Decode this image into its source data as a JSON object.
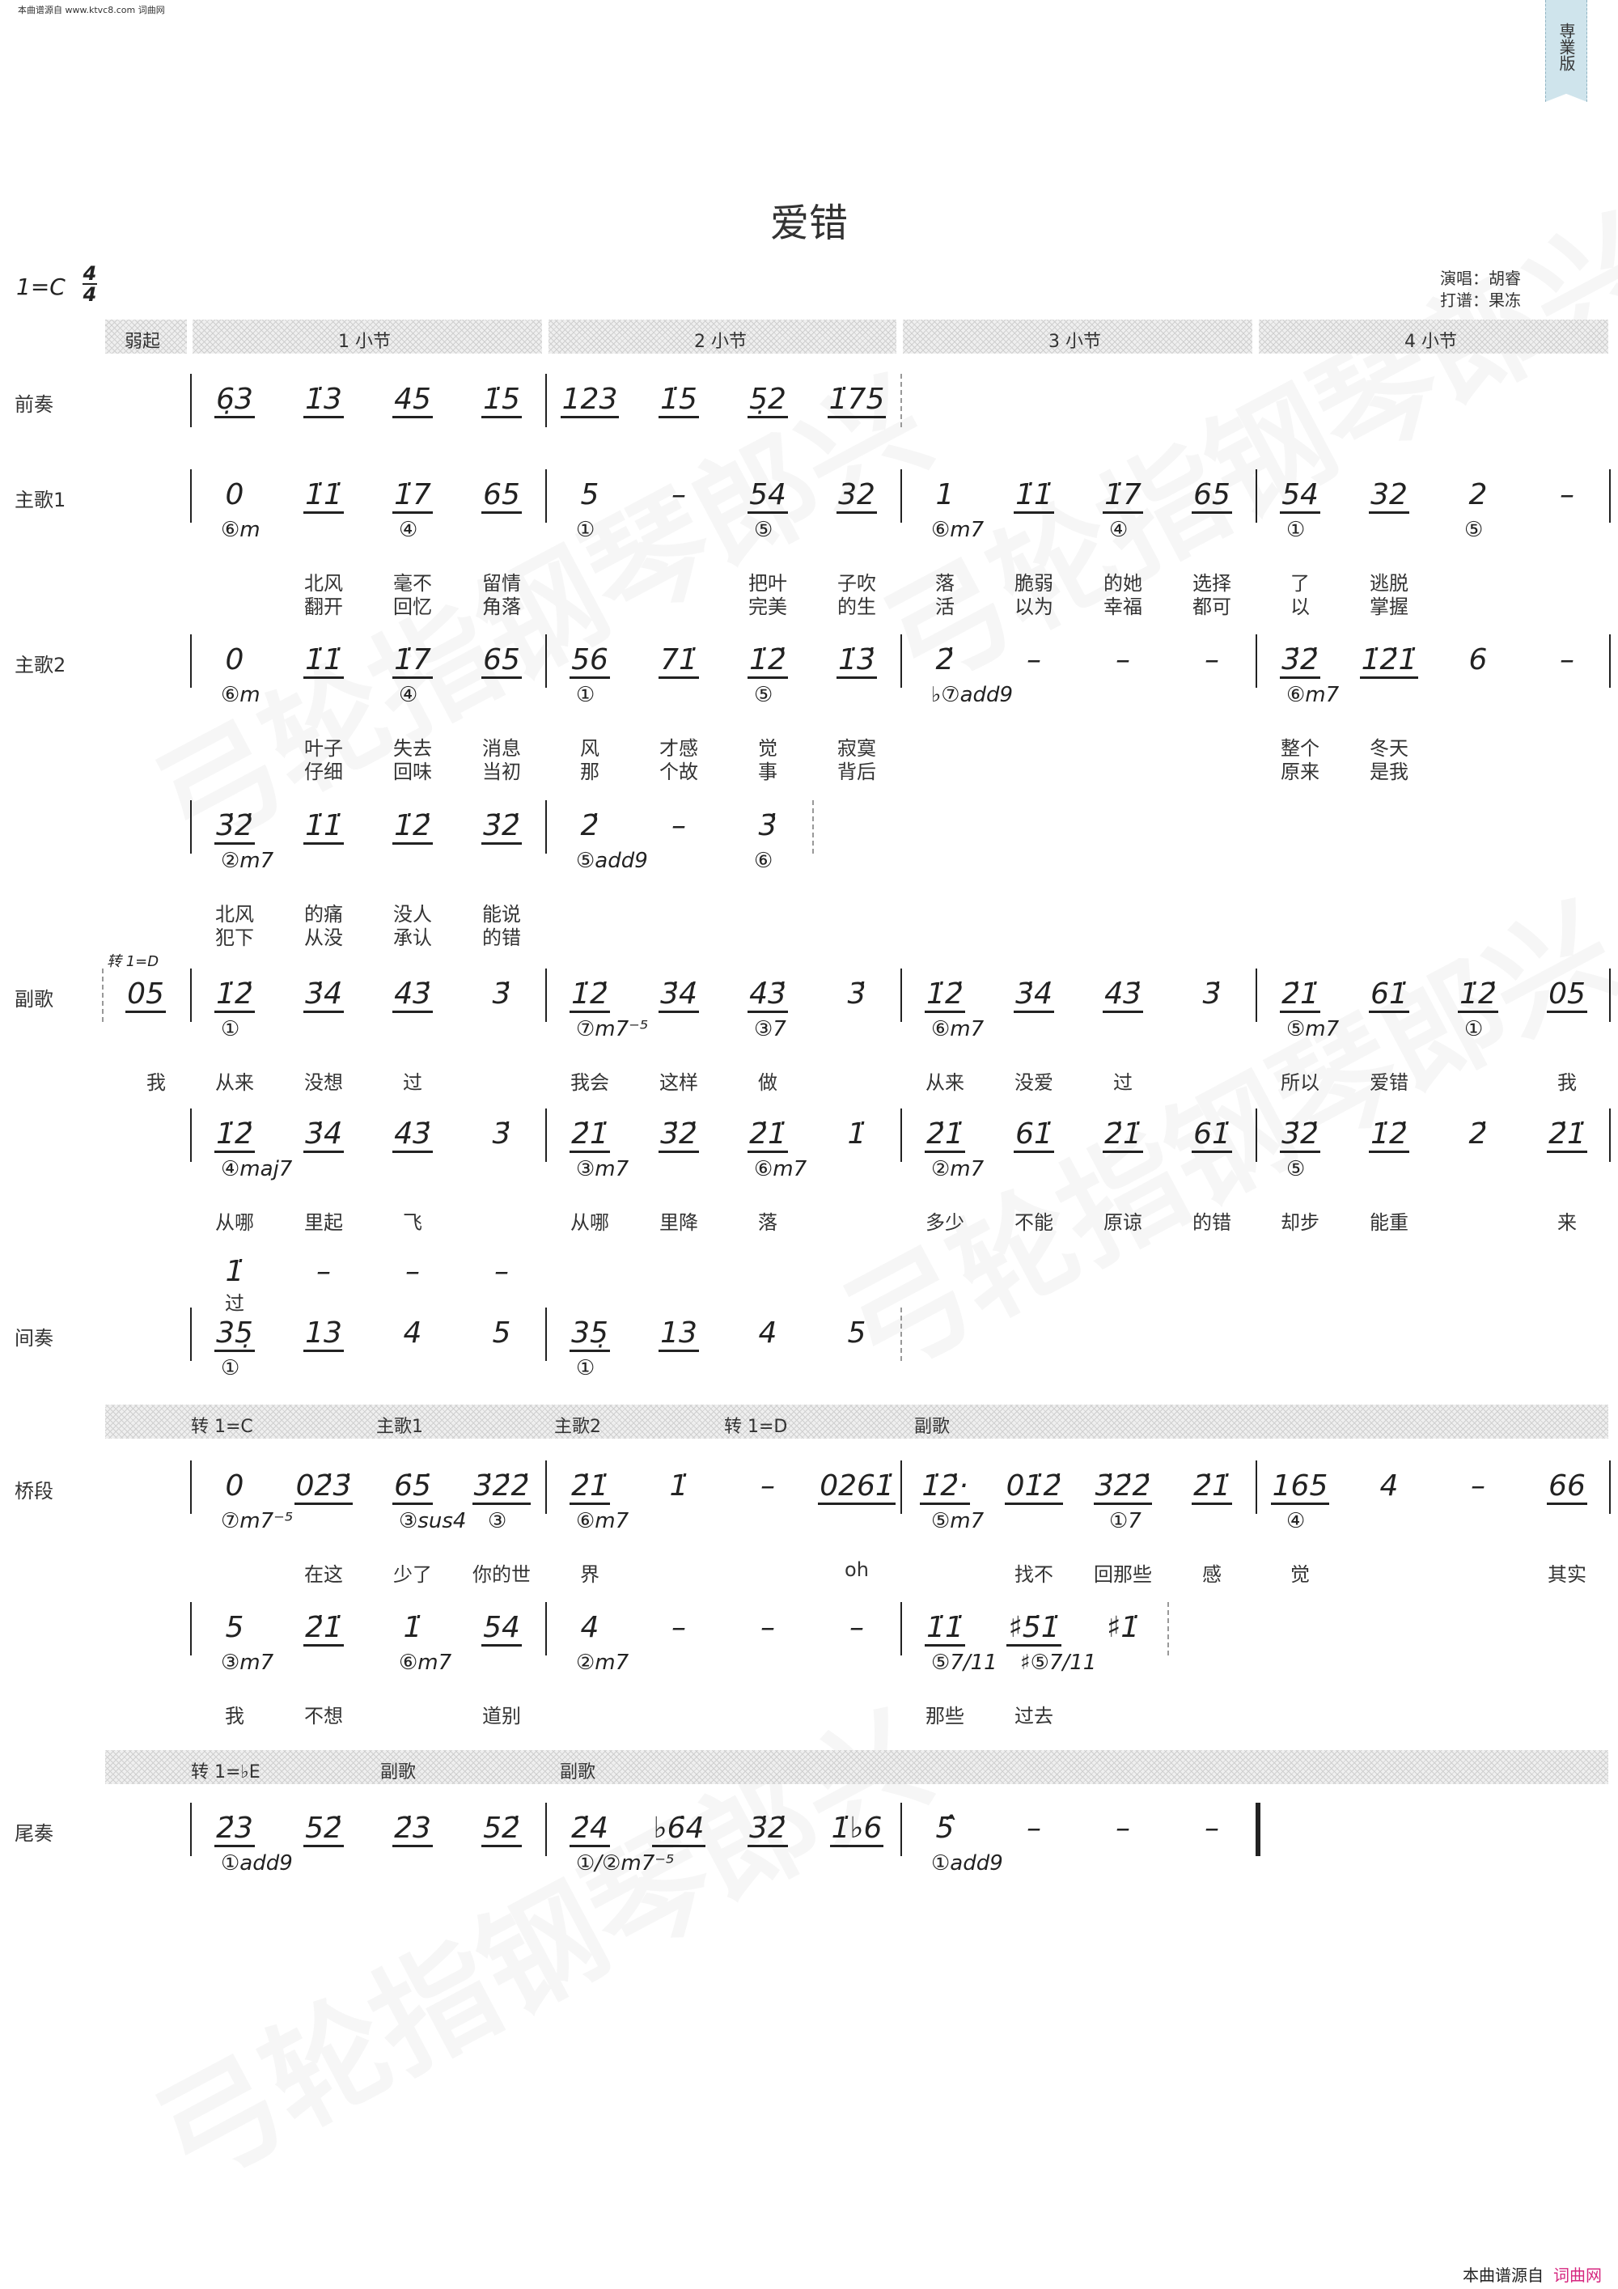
{
  "source_note": "本曲谱源自 www.ktvc8.com 词曲网",
  "ribbon": "専業版",
  "title": "爱错",
  "key": "1=C",
  "meter": {
    "top": "4",
    "bottom": "4"
  },
  "singer": "演唱：胡睿",
  "arranger": "打谱：果冻",
  "watermark": "弓轮指钢琴郎兴",
  "measure_header": [
    "弱起",
    "1 小节",
    "2 小节",
    "3 小节",
    "4 小节"
  ],
  "section_bar_1": [
    "转 1=C",
    "主歌1",
    "主歌2",
    "转 1=D",
    "副歌"
  ],
  "section_bar_2": [
    "转 1=♭E",
    "副歌",
    "副歌"
  ],
  "chorus_key_change": "转 1=D",
  "rows": [
    {
      "label": "前奏",
      "end": "dashed",
      "measures": [
        {
          "notes": [
            "6̣3",
            "1̇3",
            "45",
            "1̇5"
          ]
        },
        {
          "notes": [
            "123",
            "1̇5",
            "5̣2",
            "1̇75"
          ]
        }
      ]
    },
    {
      "label": "主歌1",
      "end": "solid",
      "measures": [
        {
          "notes": [
            "0",
            "1̇1̇",
            "1̇7",
            "65"
          ],
          "chords": [
            "⑥m",
            "",
            "④",
            ""
          ],
          "l1": [
            "",
            "北风",
            "毫不",
            "留情"
          ],
          "l2": [
            "",
            "翻开",
            "回忆",
            "角落"
          ]
        },
        {
          "notes": [
            "5",
            "–",
            "54",
            "32"
          ],
          "chords": [
            "①",
            "",
            "⑤",
            ""
          ],
          "l1": [
            "",
            "",
            "把叶",
            "子吹"
          ],
          "l2": [
            "",
            "",
            "完美",
            "的生"
          ]
        },
        {
          "notes": [
            "1",
            "1̇1̇",
            "1̇7",
            "65"
          ],
          "chords": [
            "⑥m7",
            "",
            "④",
            ""
          ],
          "l1": [
            "落",
            "脆弱",
            "的她",
            "选择"
          ],
          "l2": [
            "活",
            "以为",
            "幸福",
            "都可"
          ]
        },
        {
          "notes": [
            "54",
            "32",
            "2",
            "–"
          ],
          "chords": [
            "①",
            "",
            "⑤",
            ""
          ],
          "l1": [
            "了",
            "逃脱",
            "",
            ""
          ],
          "l2": [
            "以",
            "掌握",
            "",
            ""
          ]
        }
      ]
    },
    {
      "label": "主歌2",
      "end": "solid",
      "measures": [
        {
          "notes": [
            "0",
            "1̇1̇",
            "1̇7",
            "65"
          ],
          "chords": [
            "⑥m",
            "",
            "④",
            ""
          ],
          "l1": [
            "",
            "叶子",
            "失去",
            "消息"
          ],
          "l2": [
            "",
            "仔细",
            "回味",
            "当初"
          ]
        },
        {
          "notes": [
            "56",
            "71̇",
            "1̇2̇",
            "1̇3̇"
          ],
          "chords": [
            "①",
            "",
            "⑤",
            ""
          ],
          "l1": [
            "风",
            "才感",
            "觉",
            "寂寞"
          ],
          "l2": [
            "那",
            "个故",
            "事",
            "背后"
          ]
        },
        {
          "notes": [
            "2̇",
            "–",
            "–",
            "–"
          ],
          "chords": [
            "♭⑦add9",
            "",
            "",
            ""
          ]
        },
        {
          "notes": [
            "3̇2̇",
            "1̇2̇1̇",
            "6",
            "–"
          ],
          "chords": [
            "⑥m7",
            "",
            "",
            ""
          ],
          "l1": [
            "整个",
            "冬天",
            "",
            ""
          ],
          "l2": [
            "原来",
            "是我",
            "",
            ""
          ]
        }
      ]
    },
    {
      "label": "",
      "end": "dashed3",
      "measures": [
        {
          "notes": [
            "3̇2̇",
            "1̇1̇",
            "1̇2̇",
            "3̇2̇"
          ],
          "chords": [
            "②m7",
            "",
            "",
            ""
          ],
          "l1": [
            "北风",
            "的痛",
            "没人",
            "能说"
          ],
          "l2": [
            "犯下",
            "从没",
            "承认",
            "的错"
          ]
        },
        {
          "notes": [
            "2̇",
            "–",
            "3̇",
            ""
          ],
          "chords": [
            "⑤add9",
            "",
            "⑥",
            ""
          ]
        }
      ]
    },
    {
      "label": "副歌",
      "end": "solid",
      "pickup": {
        "note": "05",
        "lyric": "我"
      },
      "measures": [
        {
          "notes": [
            "1̇2̇",
            "3̇4̇",
            "4̇3̇",
            "3̇"
          ],
          "chords": [
            "①",
            "",
            "",
            ""
          ],
          "l1": [
            "从来",
            "没想",
            "过",
            ""
          ]
        },
        {
          "notes": [
            "1̇2̇",
            "3̇4̇",
            "4̇3̇",
            "3̇"
          ],
          "chords": [
            "⑦m7⁻⁵",
            "",
            "③7",
            ""
          ],
          "l1": [
            "我会",
            "这样",
            "做",
            ""
          ]
        },
        {
          "notes": [
            "1̇2̇",
            "3̇4̇",
            "4̇3̇",
            "3̇"
          ],
          "chords": [
            "⑥m7",
            "",
            "",
            ""
          ],
          "l1": [
            "从来",
            "没爱",
            "过",
            ""
          ]
        },
        {
          "notes": [
            "2̇1̇",
            "61̇",
            "1̇2̇",
            "05"
          ],
          "chords": [
            "⑤m7",
            "",
            "①",
            ""
          ],
          "l1": [
            "所以",
            "爱错",
            "",
            "我"
          ]
        }
      ]
    },
    {
      "label": "",
      "end": "solid",
      "measures": [
        {
          "notes": [
            "1̇2̇",
            "3̇4̇",
            "4̇3̇",
            "3̇"
          ],
          "chords": [
            "④maj7",
            "",
            "",
            ""
          ],
          "l1": [
            "从哪",
            "里起",
            "飞",
            ""
          ]
        },
        {
          "notes": [
            "2̇1̇",
            "3̇2̇",
            "2̇1̇",
            "1̇"
          ],
          "chords": [
            "③m7",
            "",
            "⑥m7",
            ""
          ],
          "l1": [
            "从哪",
            "里降",
            "落",
            ""
          ]
        },
        {
          "notes": [
            "2̇1̇",
            "61̇",
            "2̇1̇",
            "61̇"
          ],
          "chords": [
            "②m7",
            "",
            "",
            ""
          ],
          "l1": [
            "多少",
            "不能",
            "原谅",
            "的错"
          ]
        },
        {
          "notes": [
            "3̇2̇",
            "1̇2̇",
            "2̇",
            "2̇1̇"
          ],
          "chords": [
            "⑤",
            "",
            "",
            ""
          ],
          "l1": [
            "却步",
            "能重",
            "",
            "来"
          ]
        }
      ]
    },
    {
      "label": "",
      "end": "none",
      "nobar": true,
      "measures": [
        {
          "notes": [
            "1̇",
            "–",
            "–",
            "–"
          ],
          "l1": [
            "过",
            "",
            "",
            ""
          ]
        }
      ]
    },
    {
      "label": "间奏",
      "end": "dashed",
      "measures": [
        {
          "notes": [
            "35̣",
            "13",
            "4",
            "5"
          ],
          "chords": [
            "①",
            "",
            "",
            ""
          ]
        },
        {
          "notes": [
            "35̣",
            "13",
            "4",
            "5"
          ],
          "chords": [
            "①",
            "",
            "",
            ""
          ]
        }
      ]
    },
    {
      "label": "桥段",
      "end": "solid",
      "measures": [
        {
          "notes": [
            "0",
            "02̇3̇",
            "6̇5̇",
            "3̇2̇2̇"
          ],
          "chords": [
            "⑦m7⁻⁵",
            "",
            "③sus4",
            "③"
          ],
          "l1": [
            "",
            "在这",
            "少了",
            "你的世"
          ]
        },
        {
          "notes": [
            "2̇1̇",
            "1̇",
            "–",
            "0261̇"
          ],
          "chords": [
            "⑥m7",
            "",
            "",
            ""
          ],
          "l1": [
            "界",
            "",
            "",
            "oh"
          ]
        },
        {
          "notes": [
            "1̇2̇·",
            "01̇2̇",
            "3̇2̇2̇",
            "2̇1̇"
          ],
          "chords": [
            "⑤m7",
            "",
            "①7",
            ""
          ],
          "l1": [
            "",
            "找不",
            "回那些",
            "感"
          ]
        },
        {
          "notes": [
            "165",
            "4",
            "–",
            "66"
          ],
          "chords": [
            "④",
            "",
            "",
            ""
          ],
          "l1": [
            "觉",
            "",
            "",
            "其实"
          ]
        }
      ]
    },
    {
      "label": "",
      "end": "dashed3",
      "measures": [
        {
          "notes": [
            "5",
            "2̇1̇",
            "1̇",
            "54"
          ],
          "chords": [
            "③m7",
            "",
            "⑥m7",
            ""
          ],
          "l1": [
            "我",
            "不想",
            "",
            "道别"
          ]
        },
        {
          "notes": [
            "4",
            "–",
            "–",
            "–"
          ],
          "chords": [
            "②m7",
            "",
            "",
            ""
          ]
        },
        {
          "notes": [
            "1̇1̇",
            "♯5̇1̇",
            "♯1̇",
            ""
          ],
          "chords": [
            "⑤7/11",
            "♯⑤7/11",
            "",
            ""
          ],
          "l1": [
            "那些",
            "过去",
            "",
            ""
          ]
        }
      ]
    },
    {
      "label": "尾奏",
      "end": "final",
      "measures": [
        {
          "notes": [
            "2̇3",
            "52̇",
            "2̇3",
            "52̇"
          ],
          "chords": [
            "①add9",
            "",
            "",
            ""
          ]
        },
        {
          "notes": [
            "2̇4",
            "♭6̇4",
            "3̇2̇",
            "1̇♭6"
          ],
          "chords": [
            "①/②m7⁻⁵",
            "",
            "",
            ""
          ]
        },
        {
          "notes": [
            "5̂",
            "–",
            "–",
            "–"
          ],
          "chords": [
            "①add9",
            "",
            "",
            ""
          ]
        }
      ]
    }
  ],
  "footer": {
    "text": "本曲谱源自",
    "brand": "词曲网",
    "brand_color": "#d6277f"
  }
}
